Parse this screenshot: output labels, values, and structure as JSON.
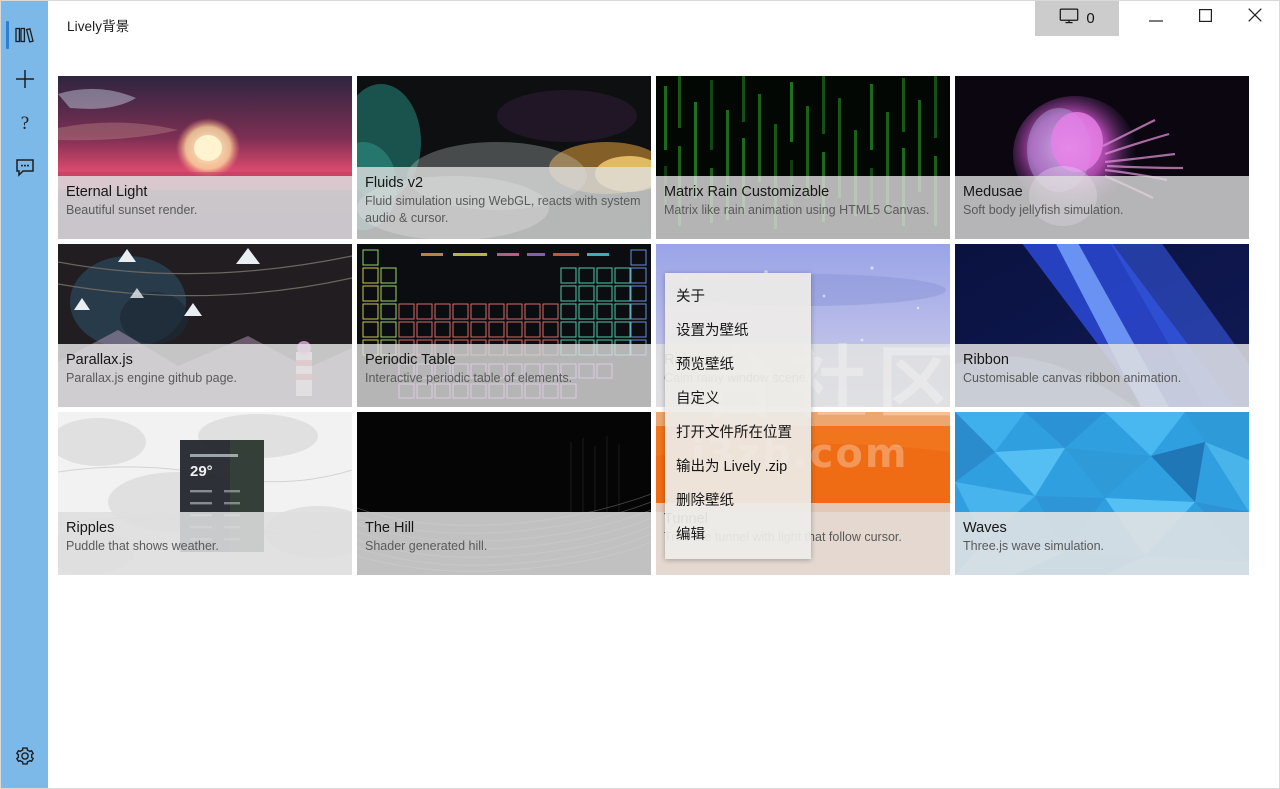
{
  "window": {
    "title": "Lively背景",
    "screen_count": "0",
    "screen_icon": "monitor-icon",
    "minimize_label": "–",
    "maximize_label": "□",
    "close_label": "✕"
  },
  "sidebar": {
    "items": [
      {
        "name": "library",
        "icon": "library-books-icon",
        "selected": true
      },
      {
        "name": "add",
        "icon": "plus-icon",
        "selected": false
      },
      {
        "name": "help",
        "icon": "question-mark-icon",
        "selected": false
      },
      {
        "name": "feedback",
        "icon": "chat-bubble-icon",
        "selected": false
      }
    ],
    "bottom": {
      "name": "settings",
      "icon": "gear-icon"
    }
  },
  "watermarks": {
    "cn": "台社区",
    "url": "i3zb.com"
  },
  "library": {
    "cards": [
      {
        "title": "Eternal Light",
        "desc": "Beautiful sunset render."
      },
      {
        "title": "Fluids v2",
        "desc": "Fluid simulation using WebGL, reacts with system audio & cursor."
      },
      {
        "title": "Matrix Rain Customizable",
        "desc": "Matrix like rain animation using HTML5 Canvas."
      },
      {
        "title": "Medusae",
        "desc": "Soft body jellyfish simulation."
      },
      {
        "title": "Parallax.js",
        "desc": "Parallax.js engine github page."
      },
      {
        "title": "Periodic Table",
        "desc": "Interactive periodic table of elements."
      },
      {
        "title": "Rain",
        "desc": "Calm rainy window scene."
      },
      {
        "title": "Ribbon",
        "desc": "Customisable canvas ribbon animation."
      },
      {
        "title": "Ripples",
        "desc": "Puddle that shows weather."
      },
      {
        "title": "The Hill",
        "desc": "Shader generated hill."
      },
      {
        "title": "Tunnel",
        "desc": "Tron like tunnel with light that follow cursor."
      },
      {
        "title": "Waves",
        "desc": "Three.js wave simulation."
      }
    ]
  },
  "context_menu": {
    "items": [
      {
        "label": "关于"
      },
      {
        "label": "设置为壁纸"
      },
      {
        "label": "预览壁纸"
      },
      {
        "label": "自定义"
      },
      {
        "label": "打开文件所在位置"
      },
      {
        "label": "输出为 Lively .zip"
      },
      {
        "label": "删除壁纸"
      },
      {
        "label": "编辑"
      }
    ]
  },
  "colors": {
    "sidebar": "#7cb8e8",
    "sidebar_selected": "#2f7fd0",
    "card_info": "rgba(224,224,224,.80)",
    "menu_bg": "rgba(238,236,232,.93)"
  }
}
